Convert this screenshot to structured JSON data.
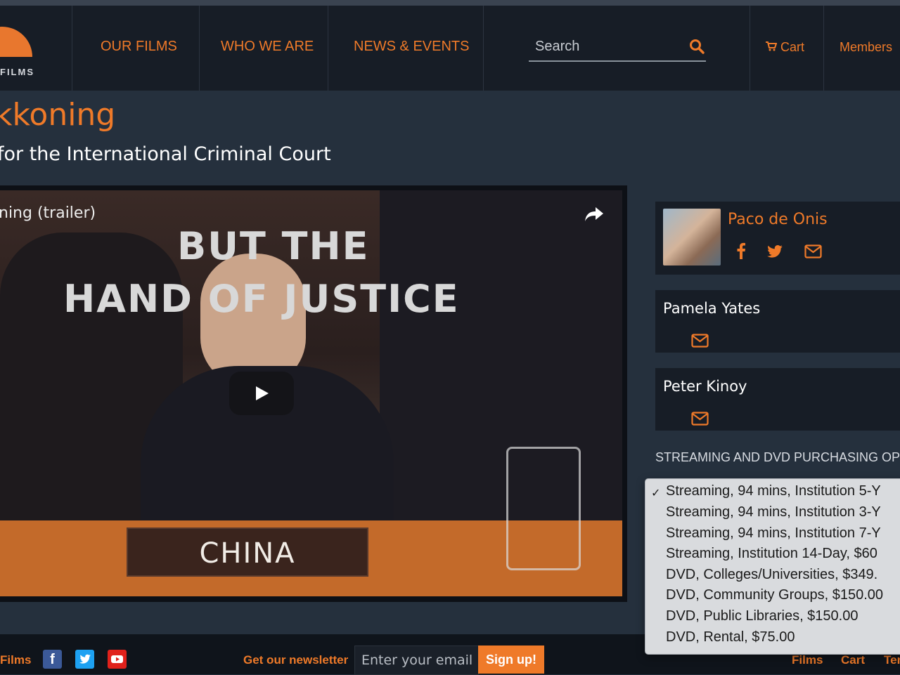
{
  "header": {
    "logo_text": "FILMS",
    "nav": [
      "OUR FILMS",
      "WHO WE ARE",
      "NEWS & EVENTS"
    ],
    "search_placeholder": "Search",
    "cart_label": "Cart",
    "members_label": "Members"
  },
  "film": {
    "title": "kkoning",
    "subtitle": "for the International Criminal Court"
  },
  "video": {
    "title": "ning (trailer)",
    "overlay_line1": "BUT THE",
    "overlay_line2": "HAND OF JUSTICE",
    "placard": "CHINA"
  },
  "authors": [
    {
      "name": "Paco de Onis"
    },
    {
      "name": "Pamela Yates"
    },
    {
      "name": "Peter Kinoy"
    }
  ],
  "purchase": {
    "label": "STREAMING AND DVD PURCHASING OPT",
    "options": [
      "Streaming, 94 mins, Institution 5-Y",
      "Streaming, 94 mins, Institution 3-Y",
      "Streaming, 94 mins, Institution 7-Y",
      "Streaming, Institution 14-Day, $60",
      "DVD, Colleges/Universities, $349.",
      "DVD, Community Groups, $150.00",
      "DVD, Public Libraries, $150.00",
      "DVD, Rental, $75.00"
    ],
    "selected_index": 0
  },
  "footer": {
    "films_label": "Films",
    "newsletter_label": "Get our newsletter",
    "email_placeholder": "Enter your email",
    "signup_label": "Sign up!",
    "links": [
      "Films",
      "Cart",
      "Ter"
    ]
  },
  "colors": {
    "accent": "#ef7a29",
    "background": "#25303d",
    "header_bg": "#171d26"
  }
}
